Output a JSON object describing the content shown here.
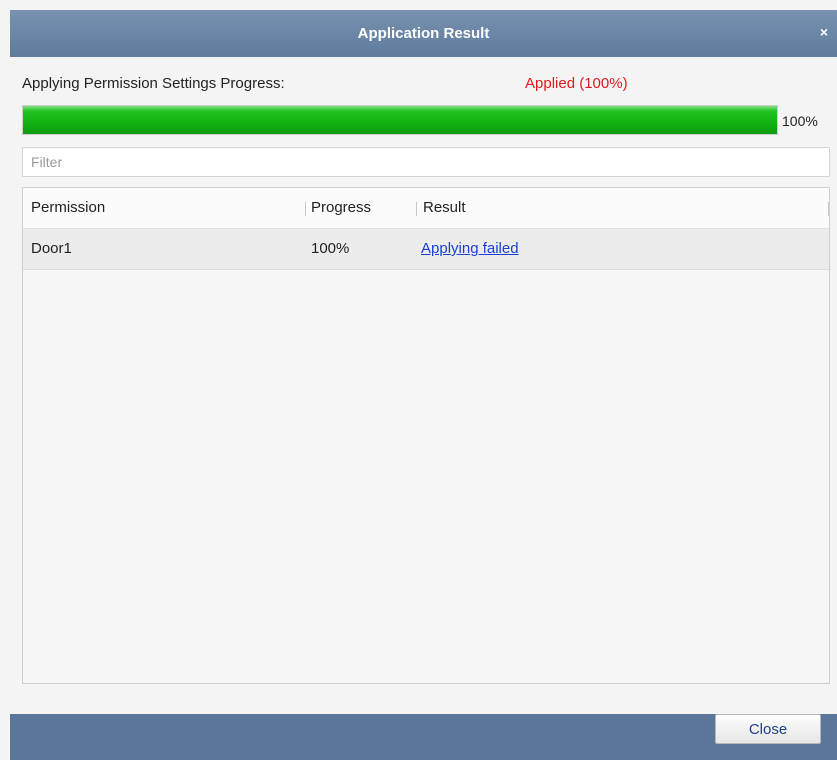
{
  "dialog": {
    "title": "Application Result",
    "close_icon": "×"
  },
  "progress": {
    "label": "Applying Permission Settings Progress:",
    "status": "Applied (100%)",
    "status_color": "#e0191f",
    "percent_text": "100%",
    "fraction": 1.0
  },
  "filter": {
    "placeholder": "Filter",
    "value": ""
  },
  "table": {
    "columns": [
      "Permission",
      "Progress",
      "Result"
    ],
    "rows": [
      {
        "permission": "Door1",
        "progress": "100%",
        "result": "Applying failed"
      }
    ]
  },
  "footer": {
    "close_label": "Close"
  }
}
